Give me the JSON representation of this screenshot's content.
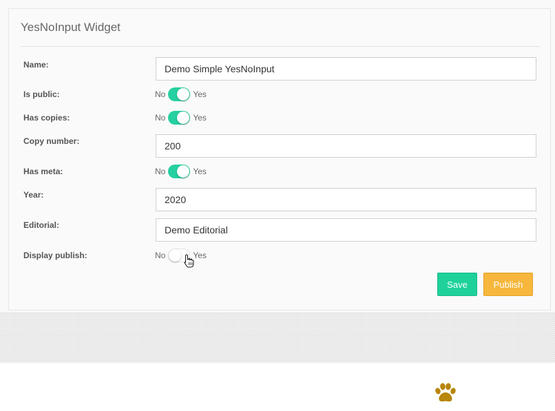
{
  "widget": {
    "title": "YesNoInput Widget"
  },
  "fields": {
    "name": {
      "label": "Name:",
      "value": "Demo Simple YesNoInput"
    },
    "is_public": {
      "label": "Is public:",
      "no": "No",
      "yes": "Yes",
      "state": "on"
    },
    "has_copies": {
      "label": "Has copies:",
      "no": "No",
      "yes": "Yes",
      "state": "on"
    },
    "copy_number": {
      "label": "Copy number:",
      "value": "200"
    },
    "has_meta": {
      "label": "Has meta:",
      "no": "No",
      "yes": "Yes",
      "state": "on"
    },
    "year": {
      "label": "Year:",
      "value": "2020"
    },
    "editorial": {
      "label": "Editorial:",
      "value": "Demo Editorial"
    },
    "display_publish": {
      "label": "Display publish:",
      "no": "No",
      "yes": "Yes",
      "state": "off"
    }
  },
  "actions": {
    "save_label": "Save",
    "publish_label": "Publish"
  },
  "colors": {
    "toggle_on": "#26d0a0",
    "save": "#1ed19b",
    "publish": "#f6b73c",
    "paw": "#b8860b"
  },
  "icons": {
    "footer": "paw-icon",
    "pointer": "hand-cursor-icon"
  }
}
